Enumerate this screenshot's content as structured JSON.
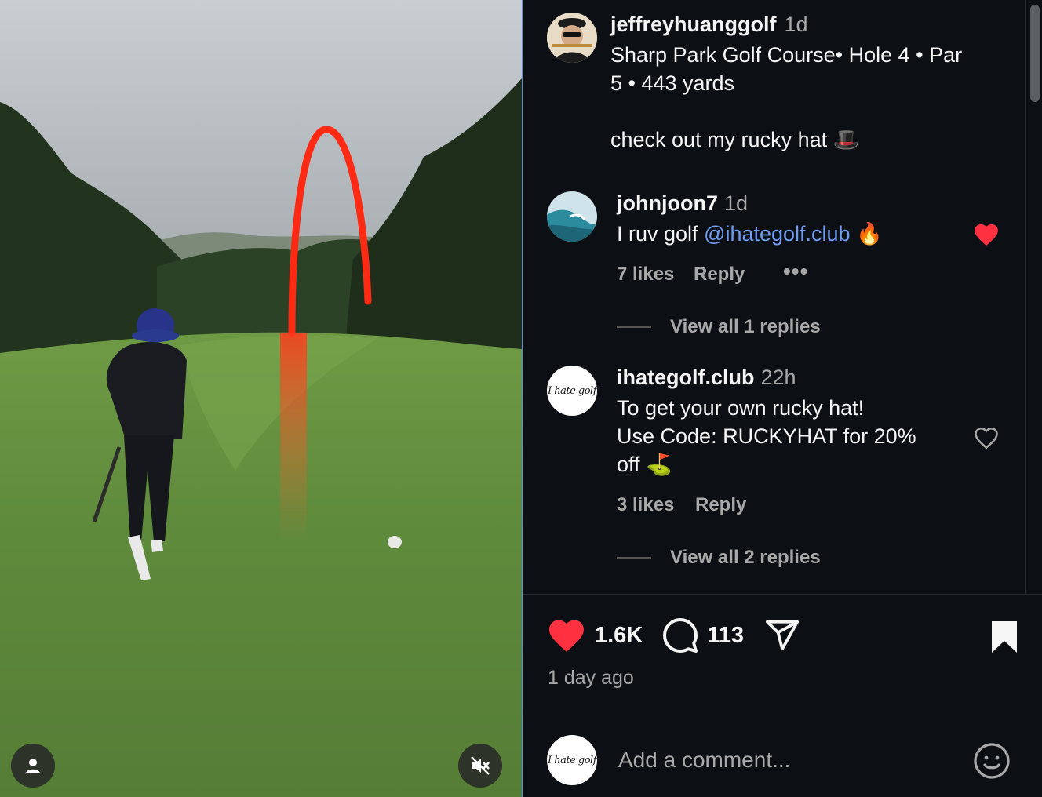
{
  "post": {
    "author": "jeffreyhuanggolf",
    "time": "1d",
    "caption_line1": "Sharp Park Golf Course• Hole 4 • Par",
    "caption_line2": "5 • 443 yards",
    "caption_line3": "check out my rucky hat 🎩"
  },
  "comments": [
    {
      "user": "johnjoon7",
      "time": "1d",
      "text_prefix": "I ruv golf ",
      "mention": "@ihategolf.club",
      "text_suffix": " 🔥",
      "likes": "7 likes",
      "reply": "Reply",
      "more": "•••",
      "liked": true,
      "view_replies": "View all 1 replies"
    },
    {
      "user": "ihategolf.club",
      "time": "22h",
      "line1": "To get your own rucky hat!",
      "line2": "Use Code: RUCKYHAT for 20%",
      "line3": "off ⛳",
      "likes": "3 likes",
      "reply": "Reply",
      "liked": false,
      "view_replies": "View all 2 replies"
    }
  ],
  "actions": {
    "like_count": "1.6K",
    "comment_count": "113",
    "posted_ago": "1 day ago"
  },
  "composer": {
    "placeholder": "Add a comment..."
  },
  "logo_text": "I hate golf",
  "colors": {
    "background": "#0c1014",
    "like_red": "#ff3040",
    "link_blue": "#6f9cf0",
    "muted": "#a8a8a8",
    "tracer": "#ff2a14"
  },
  "icons": [
    "user-icon",
    "muted-speaker-icon",
    "heart-icon",
    "comment-icon",
    "share-icon",
    "bookmark-icon",
    "emoji-icon"
  ]
}
